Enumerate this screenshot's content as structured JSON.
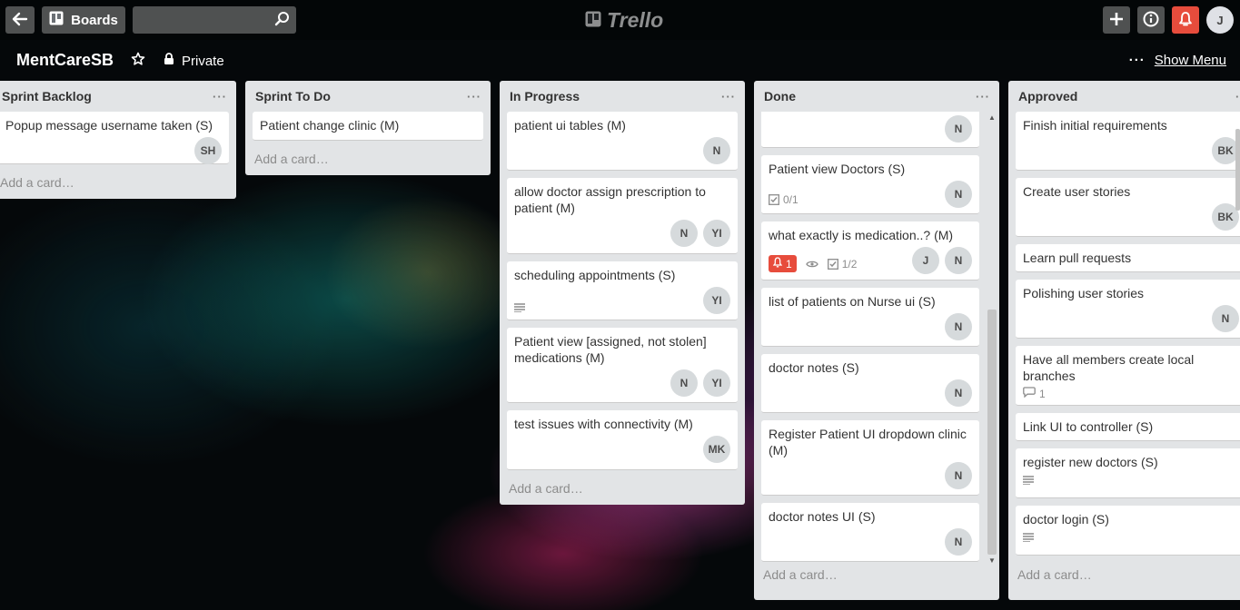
{
  "header": {
    "boards_label": "Boards",
    "search_placeholder": "",
    "logo_text": "Trello",
    "user_initial": "J"
  },
  "board": {
    "title": "MentCareSB",
    "privacy": "Private",
    "show_menu": "Show Menu"
  },
  "colors": {
    "alert": "#e74c3c",
    "list_bg": "#e2e4e6"
  },
  "lists": [
    {
      "title": "Sprint Backlog",
      "add_card": "Add a card…",
      "cards": [
        {
          "title": "Popup message username taken (S)",
          "members": [
            "SH"
          ]
        }
      ]
    },
    {
      "title": "Sprint To Do",
      "add_card": "Add a card…",
      "cards": [
        {
          "title": "Patient change clinic (M)",
          "members": []
        }
      ]
    },
    {
      "title": "In Progress",
      "add_card": "Add a card…",
      "cards": [
        {
          "title": "patient ui tables (M)",
          "members": [
            "N"
          ]
        },
        {
          "title": "allow doctor assign prescription to patient (M)",
          "members": [
            "N",
            "YI"
          ]
        },
        {
          "title": "scheduling appointments (S)",
          "members": [
            "YI"
          ],
          "badges": {
            "description": true
          }
        },
        {
          "title": "Patient view [assigned, not stolen] medications (M)",
          "members": [
            "N",
            "YI"
          ]
        },
        {
          "title": "test issues with connectivity (M)",
          "members": [
            "MK"
          ]
        }
      ]
    },
    {
      "title": "Done",
      "add_card": "Add a card…",
      "cards": [
        {
          "title": "",
          "members": [
            "N"
          ]
        },
        {
          "title": "Patient view Doctors (S)",
          "members": [
            "N"
          ],
          "badges": {
            "checklist": "0/1"
          }
        },
        {
          "title": "what exactly is medication..? (M)",
          "members": [
            "J",
            "N"
          ],
          "badges": {
            "notifications": "1",
            "watching": true,
            "checklist": "1/2"
          }
        },
        {
          "title": "list of patients on Nurse ui (S)",
          "members": [
            "N"
          ]
        },
        {
          "title": "doctor notes (S)",
          "members": [
            "N"
          ]
        },
        {
          "title": "Register Patient UI dropdown clinic (M)",
          "members": [
            "N"
          ]
        },
        {
          "title": "doctor notes UI (S)",
          "members": [
            "N"
          ]
        }
      ]
    },
    {
      "title": "Approved",
      "add_card": "Add a card…",
      "cards": [
        {
          "title": "Finish initial requirements",
          "members": [
            "BK"
          ]
        },
        {
          "title": "Create user stories",
          "members": [
            "BK"
          ]
        },
        {
          "title": "Learn pull requests",
          "members": []
        },
        {
          "title": "Polishing user stories",
          "members": [
            "N"
          ]
        },
        {
          "title": "Have all members create local branches",
          "members": [],
          "badges": {
            "comments": "1"
          }
        },
        {
          "title": "Link UI to controller (S)",
          "members": []
        },
        {
          "title": "register new doctors (S)",
          "members": [],
          "badges": {
            "description": true
          }
        },
        {
          "title": "doctor login (S)",
          "members": [],
          "badges": {
            "description": true
          }
        }
      ]
    }
  ]
}
